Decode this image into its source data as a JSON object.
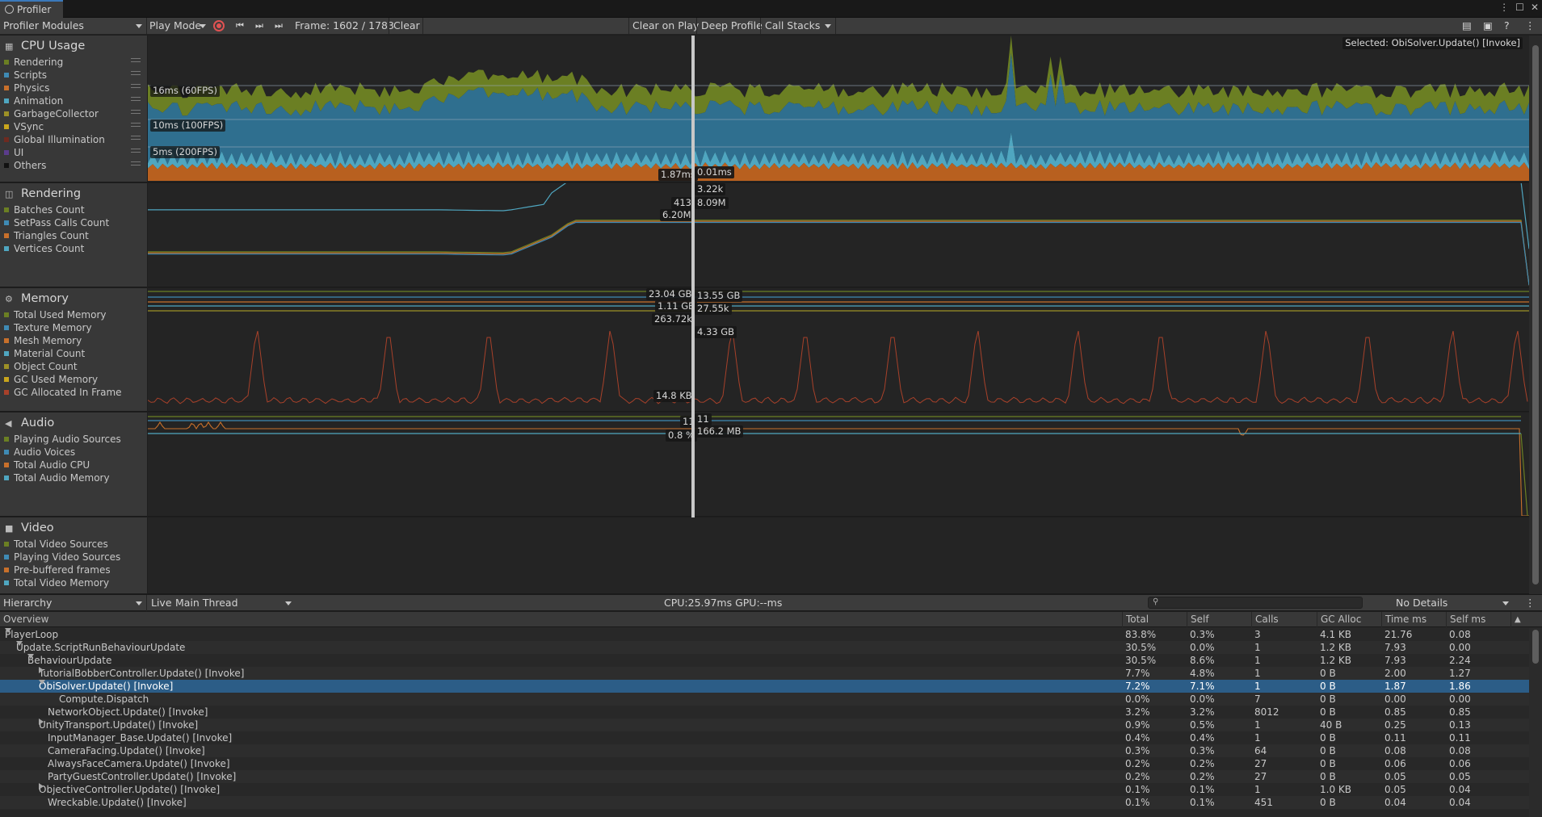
{
  "window": {
    "title": "Profiler"
  },
  "toolbar": {
    "modules_label": "Profiler Modules",
    "play_mode_label": "Play Mode",
    "frame_label": "Frame: 1602 / 1783",
    "clear_label": "Clear",
    "clear_on_play_label": "Clear on Play",
    "deep_profile_label": "Deep Profile",
    "call_stacks_label": "Call Stacks"
  },
  "cpu": {
    "title": "CPU Usage",
    "legend": [
      {
        "label": "Rendering",
        "color": "#6b7f23"
      },
      {
        "label": "Scripts",
        "color": "#3f8ab4"
      },
      {
        "label": "Physics",
        "color": "#c8702b"
      },
      {
        "label": "Animation",
        "color": "#4fa6c0"
      },
      {
        "label": "GarbageCollector",
        "color": "#9c9026"
      },
      {
        "label": "VSync",
        "color": "#c8a51c"
      },
      {
        "label": "Global Illumination",
        "color": "#6e2a20"
      },
      {
        "label": "UI",
        "color": "#5b3c8c"
      },
      {
        "label": "Others",
        "color": "#111111"
      }
    ],
    "guide_60": "16ms (60FPS)",
    "guide_100": "10ms (100FPS)",
    "guide_200": "5ms (200FPS)",
    "selected": "Selected: ObiSolver.Update() [Invoke]",
    "val_left": "1.87ms",
    "val_right": "0.01ms"
  },
  "rendering": {
    "title": "Rendering",
    "legend": [
      {
        "label": "Batches Count",
        "color": "#6b7f23"
      },
      {
        "label": "SetPass Calls Count",
        "color": "#3f8ab4"
      },
      {
        "label": "Triangles Count",
        "color": "#c8702b"
      },
      {
        "label": "Vertices Count",
        "color": "#4fa6c0"
      }
    ],
    "v1": "3.22k",
    "v2": "413",
    "v3": "8.09M",
    "v4": "6.20M"
  },
  "memory": {
    "title": "Memory",
    "legend": [
      {
        "label": "Total Used Memory",
        "color": "#6b7f23"
      },
      {
        "label": "Texture Memory",
        "color": "#3f8ab4"
      },
      {
        "label": "Mesh Memory",
        "color": "#c8702b"
      },
      {
        "label": "Material Count",
        "color": "#4fa6c0"
      },
      {
        "label": "Object Count",
        "color": "#9c9026"
      },
      {
        "label": "GC Used Memory",
        "color": "#c8a51c"
      },
      {
        "label": "GC Allocated In Frame",
        "color": "#a8412a"
      }
    ],
    "v1": "23.04 GB",
    "v2": "13.55 GB",
    "v3": "1.11 GB",
    "v4": "27.55k",
    "v5": "263.72k",
    "v6": "4.33 GB",
    "v7": "14.8 KB"
  },
  "audio": {
    "title": "Audio",
    "legend": [
      {
        "label": "Playing Audio Sources",
        "color": "#6b7f23"
      },
      {
        "label": "Audio Voices",
        "color": "#3f8ab4"
      },
      {
        "label": "Total Audio CPU",
        "color": "#c8702b"
      },
      {
        "label": "Total Audio Memory",
        "color": "#4fa6c0"
      }
    ],
    "v1": "11",
    "v2": "11",
    "v3": "166.2 MB",
    "v4": "0.8 %"
  },
  "video": {
    "title": "Video",
    "legend": [
      {
        "label": "Total Video Sources",
        "color": "#6b7f23"
      },
      {
        "label": "Playing Video Sources",
        "color": "#3f8ab4"
      },
      {
        "label": "Pre-buffered frames",
        "color": "#c8702b"
      },
      {
        "label": "Total Video Memory",
        "color": "#4fa6c0"
      }
    ]
  },
  "details_bar": {
    "view_label": "Hierarchy",
    "live_label": "Live",
    "thread_label": "Main Thread",
    "cpu_gpu": "CPU:25.97ms   GPU:--ms",
    "details_label": "No Details"
  },
  "table": {
    "headers": {
      "overview": "Overview",
      "total": "Total",
      "self": "Self",
      "calls": "Calls",
      "gc": "GC Alloc",
      "time": "Time ms",
      "selfms": "Self ms"
    },
    "rows": [
      {
        "name": "PlayerLoop",
        "total": "83.8%",
        "self": "0.3%",
        "calls": "3",
        "gc": "4.1 KB",
        "time": "21.76",
        "selfms": "0.08"
      },
      {
        "name": "Update.ScriptRunBehaviourUpdate",
        "total": "30.5%",
        "self": "0.0%",
        "calls": "1",
        "gc": "1.2 KB",
        "time": "7.93",
        "selfms": "0.00"
      },
      {
        "name": "BehaviourUpdate",
        "total": "30.5%",
        "self": "8.6%",
        "calls": "1",
        "gc": "1.2 KB",
        "time": "7.93",
        "selfms": "2.24"
      },
      {
        "name": "TutorialBobberController.Update() [Invoke]",
        "total": "7.7%",
        "self": "4.8%",
        "calls": "1",
        "gc": "0 B",
        "time": "2.00",
        "selfms": "1.27"
      },
      {
        "name": "ObiSolver.Update() [Invoke]",
        "total": "7.2%",
        "self": "7.1%",
        "calls": "1",
        "gc": "0 B",
        "time": "1.87",
        "selfms": "1.86"
      },
      {
        "name": "Compute.Dispatch",
        "total": "0.0%",
        "self": "0.0%",
        "calls": "7",
        "gc": "0 B",
        "time": "0.00",
        "selfms": "0.00"
      },
      {
        "name": "NetworkObject.Update() [Invoke]",
        "total": "3.2%",
        "self": "3.2%",
        "calls": "8012",
        "gc": "0 B",
        "time": "0.85",
        "selfms": "0.85"
      },
      {
        "name": "UnityTransport.Update() [Invoke]",
        "total": "0.9%",
        "self": "0.5%",
        "calls": "1",
        "gc": "40 B",
        "time": "0.25",
        "selfms": "0.13"
      },
      {
        "name": "InputManager_Base.Update() [Invoke]",
        "total": "0.4%",
        "self": "0.4%",
        "calls": "1",
        "gc": "0 B",
        "time": "0.11",
        "selfms": "0.11"
      },
      {
        "name": "CameraFacing.Update() [Invoke]",
        "total": "0.3%",
        "self": "0.3%",
        "calls": "64",
        "gc": "0 B",
        "time": "0.08",
        "selfms": "0.08"
      },
      {
        "name": "AlwaysFaceCamera.Update() [Invoke]",
        "total": "0.2%",
        "self": "0.2%",
        "calls": "27",
        "gc": "0 B",
        "time": "0.06",
        "selfms": "0.06"
      },
      {
        "name": "PartyGuestController.Update() [Invoke]",
        "total": "0.2%",
        "self": "0.2%",
        "calls": "27",
        "gc": "0 B",
        "time": "0.05",
        "selfms": "0.05"
      },
      {
        "name": "ObjectiveController.Update() [Invoke]",
        "total": "0.1%",
        "self": "0.1%",
        "calls": "1",
        "gc": "1.0 KB",
        "time": "0.05",
        "selfms": "0.04"
      },
      {
        "name": "Wreckable.Update() [Invoke]",
        "total": "0.1%",
        "self": "0.1%",
        "calls": "451",
        "gc": "0 B",
        "time": "0.04",
        "selfms": "0.04"
      }
    ]
  }
}
